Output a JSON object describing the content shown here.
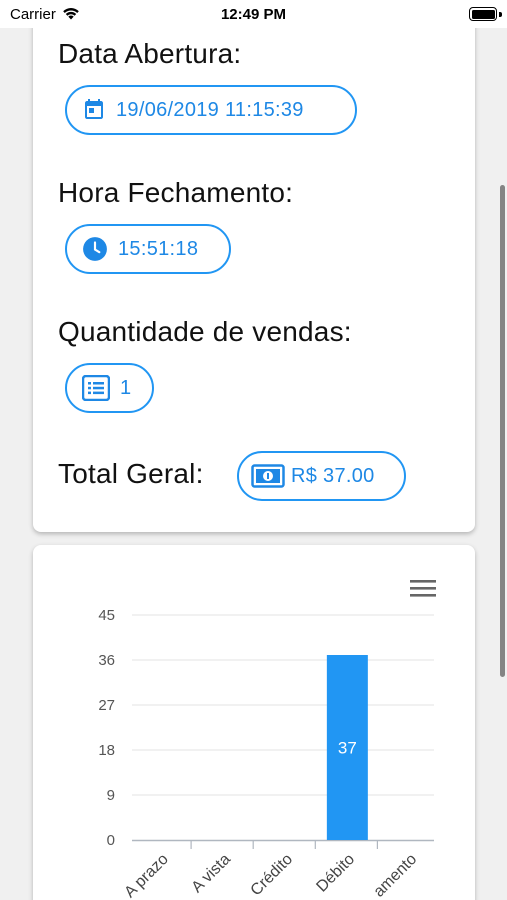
{
  "status_bar": {
    "carrier": "Carrier",
    "time": "12:49 PM"
  },
  "info": {
    "opening_label": "Data Abertura:",
    "opening_value": "19/06/2019 11:15:39",
    "closing_label": "Hora Fechamento:",
    "closing_value": "15:51:18",
    "sales_label": "Quantidade de vendas:",
    "sales_value": "1",
    "total_label": "Total Geral:",
    "total_value": "R$ 37.00"
  },
  "icons": {
    "calendar": "calendar-icon",
    "clock": "clock-icon",
    "list": "list-icon",
    "money": "money-icon",
    "menu": "menu-icon"
  },
  "colors": {
    "accent": "#2196f3",
    "chip_text": "#1e88e5",
    "bar": "#2196f3"
  },
  "chart_data": {
    "type": "bar",
    "categories": [
      "A prazo",
      "A vista",
      "Crédito",
      "Débito",
      "amento"
    ],
    "values": [
      0,
      0,
      0,
      37,
      0
    ],
    "data_labels": [
      "",
      "",
      "",
      "37",
      ""
    ],
    "y_ticks": [
      0,
      9,
      18,
      27,
      36,
      45
    ],
    "ylim": [
      0,
      45
    ],
    "grid": true
  }
}
